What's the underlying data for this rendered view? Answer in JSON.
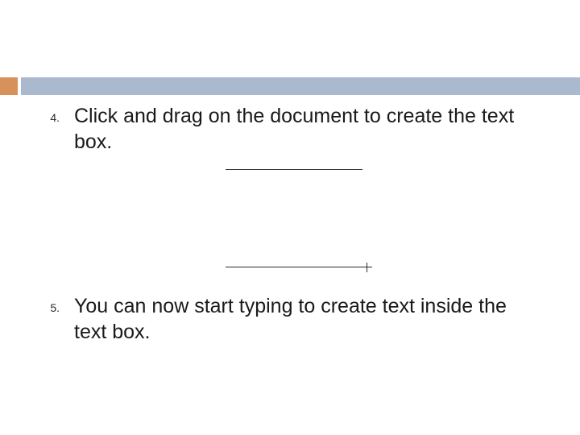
{
  "colors": {
    "accent": "#d7925b",
    "bar": "#aab9ce"
  },
  "list": {
    "items": [
      {
        "number": "4.",
        "text": "Click and drag on the document to create the text box."
      },
      {
        "number": "5.",
        "text": "You can now start typing to create text inside the text box."
      }
    ]
  }
}
